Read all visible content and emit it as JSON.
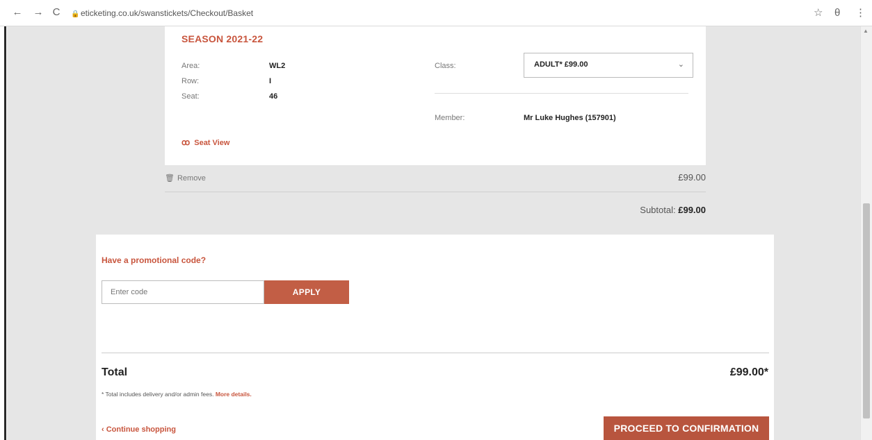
{
  "browser": {
    "back_icon": "←",
    "forward_icon": "→",
    "reload_icon": "C",
    "url": "eticketing.co.uk/swanstickets/Checkout/Basket",
    "star_icon": "☆",
    "account_icon": "θ",
    "menu_icon": "⋮"
  },
  "ticket": {
    "season": "SEASON 2021-22",
    "area_label": "Area:",
    "area_value": "WL2",
    "row_label": "Row:",
    "row_value": "I",
    "seat_label": "Seat:",
    "seat_value": "46",
    "class_label": "Class:",
    "class_value": "ADULT* £99.00",
    "member_label": "Member:",
    "member_value": "Mr Luke Hughes (157901)",
    "seat_view_label": "Seat View"
  },
  "basket": {
    "remove_label": "Remove",
    "item_price": "£99.00",
    "subtotal_label": "Subtotal:",
    "subtotal_value": "£99.00"
  },
  "promo": {
    "title": "Have a promotional code?",
    "placeholder": "Enter code",
    "apply_label": "APPLY"
  },
  "total": {
    "label": "Total",
    "value": "£99.00*",
    "note": "* Total includes delivery and/or admin fees.",
    "more_details": "More details."
  },
  "actions": {
    "continue_label": "Continue shopping",
    "proceed_label": "PROCEED TO CONFIRMATION"
  },
  "colors": {
    "accent": "#c8553d",
    "button": "#c25e45"
  }
}
